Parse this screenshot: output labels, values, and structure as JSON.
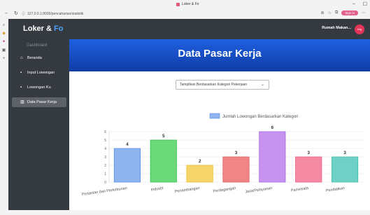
{
  "browser": {
    "tab_title": "Loker & Fo",
    "url": "127.0.0.1:8000/pencaharian/statistik",
    "profile_label": "Sign in"
  },
  "header": {
    "brand_main": "Loker & ",
    "brand_accent": "Fo",
    "user_name": "Rumah Makan...",
    "avatar_text": "img"
  },
  "sidebar": {
    "heading": "Dashboard",
    "items": [
      {
        "label": "Beranda",
        "icon": "home-icon"
      },
      {
        "label": "Input Lowongan",
        "icon": "briefcase-icon"
      },
      {
        "label": "Lowongan Ku",
        "icon": "briefcase-icon"
      },
      {
        "label": "Data Pasar Kerja",
        "icon": "chart-icon",
        "active": true
      }
    ]
  },
  "main": {
    "banner_title": "Data Pasar Kerja",
    "filter_select": "Tampilkan Berdasarkan Kategori Pekerjaan"
  },
  "colors": {
    "header_bg": "#343a40",
    "banner_blue": "#1f5fe0",
    "accent_blue": "#4fa3ff"
  },
  "chart_data": {
    "type": "bar",
    "categories": [
      "Pertanian dan Perkebunan",
      "Industri",
      "Pertambangan",
      "Perdagangan",
      "Jasa/Pelayanan",
      "Pariwisata",
      "Pendidikan"
    ],
    "series": [
      {
        "name": "Jumlah Lowongan Berdasarkan Kategori",
        "values": [
          4,
          5,
          2,
          3,
          6,
          3,
          3
        ]
      }
    ],
    "bar_fill": [
      "#8fb3ef",
      "#6ad97a",
      "#f6d56a",
      "#f08585",
      "#c793f0",
      "#f58aa5",
      "#6fd1c6"
    ],
    "bar_stroke": [
      "#5b8ee6",
      "#33c04a",
      "#eebf2e",
      "#e45a5a",
      "#a865e6",
      "#ef5c84",
      "#3fbfb0"
    ],
    "ylim": [
      0,
      6
    ],
    "yticks": [
      "0",
      "1",
      "2",
      "3",
      "4",
      "5",
      "6"
    ],
    "legend": "top",
    "grid": true
  }
}
